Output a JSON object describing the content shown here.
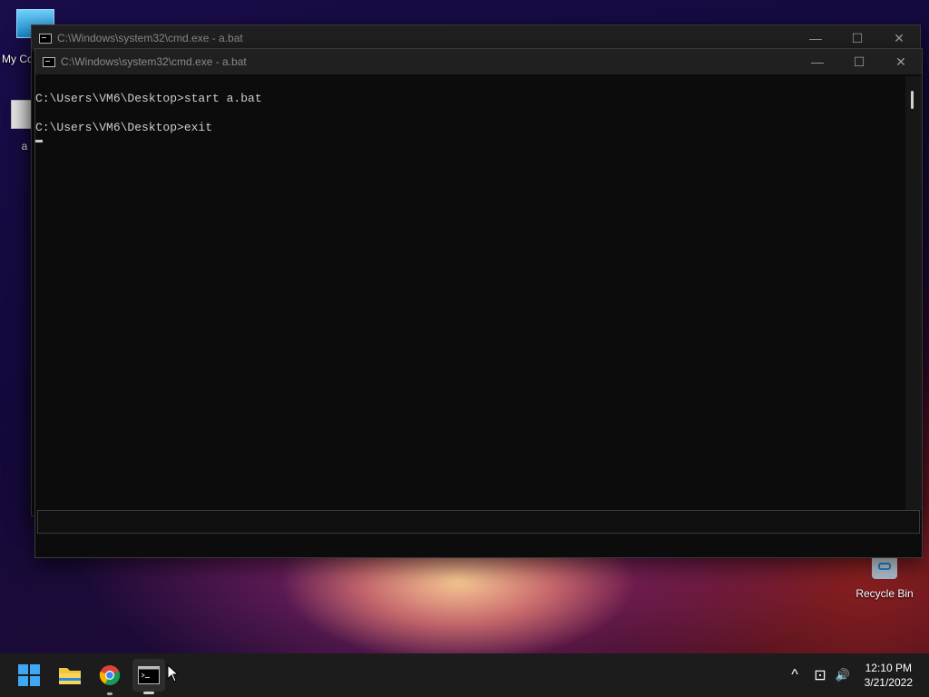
{
  "desktop": {
    "icons": [
      {
        "label": "My Co"
      },
      {
        "label": "a"
      },
      {
        "label": "Recycle Bin"
      }
    ]
  },
  "back_window": {
    "title": "C:\\Windows\\system32\\cmd.exe - a.bat",
    "controls": {
      "minimize": "—",
      "maximize": "☐",
      "close": "✕"
    }
  },
  "front_window": {
    "title": "C:\\Windows\\system32\\cmd.exe - a.bat",
    "controls": {
      "minimize": "—",
      "maximize": "☐",
      "close": "✕"
    },
    "console_lines": [
      "C:\\Users\\VM6\\Desktop>start a.bat",
      "C:\\Users\\VM6\\Desktop>exit"
    ]
  },
  "taskbar": {
    "pinned": [
      "start-button",
      "file-explorer",
      "chrome",
      "command-prompt"
    ],
    "tray": {
      "overflow": "^",
      "network": "⊡",
      "volume": "🔊"
    },
    "clock": {
      "time": "12:10 PM",
      "date": "3/21/2022"
    }
  },
  "colors": {
    "console_bg": "#0c0c0c",
    "console_text": "#cccccc",
    "taskbar_bg": "#1c1c1c",
    "accent": "#0078d4"
  }
}
